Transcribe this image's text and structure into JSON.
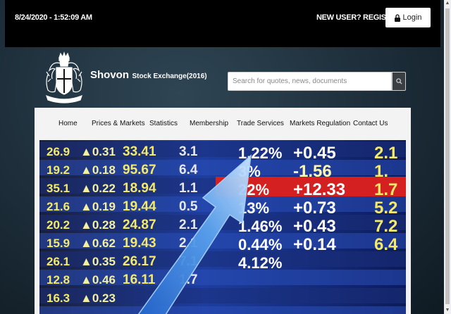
{
  "header": {
    "datetime": "8/24/2020 - 1:52:09 AM",
    "register": "NEW USER? REGISTER HERE",
    "login_label": "Login"
  },
  "brand": {
    "name": "Shovon",
    "subtitle": "Stock Exchange(2016)"
  },
  "search": {
    "placeholder": "Search for quotes, news, documents"
  },
  "nav": {
    "items": [
      {
        "label": "Home"
      },
      {
        "label": "Prices & Markets"
      },
      {
        "label": "Statistics"
      },
      {
        "label": "Membership"
      },
      {
        "label": "Trade Services"
      },
      {
        "label": "Markets Regulation"
      },
      {
        "label": "Contact Us"
      }
    ]
  },
  "hero": {
    "col1": [
      "26.9",
      "19.2",
      "35.1",
      "21.6",
      "20.2",
      "15.9",
      "26.1",
      "12.8",
      "16.3"
    ],
    "col2": [
      "0.31",
      "0.18",
      "0.22",
      "0.19",
      "0.28",
      "0.62",
      "0.35",
      "0.46",
      "0.23"
    ],
    "col3": [
      "33.41",
      "95.67",
      "18.94",
      "19.44",
      "24.87",
      "19.43",
      "26.17",
      "16.11"
    ],
    "col4": [
      "3.1",
      "6.4",
      "1.1",
      "0.5",
      "2.1",
      "2.1",
      "7.1",
      "1.7"
    ],
    "col5": [
      "1.22%",
      "3%",
      "22%",
      "13%",
      "1.46%",
      "0.44%",
      "4.12%"
    ],
    "col6": [
      "+0.45",
      "-1.56",
      "+12.33",
      "+0.73",
      "+0.43",
      "+0.14"
    ],
    "col7": [
      "2.1",
      "1.",
      "1.7",
      "5.2",
      "7.2",
      "6.4"
    ]
  }
}
